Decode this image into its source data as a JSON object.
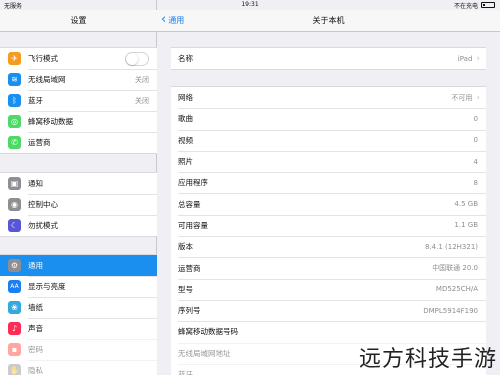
{
  "status_bar": {
    "carrier": "无服务",
    "time": "19:31",
    "charging": "不在充电",
    "battery_level": 0.15
  },
  "left": {
    "title": "设置",
    "group1": [
      {
        "label": "飞行模式",
        "icon": "airplane-icon",
        "color": "#f59b20",
        "glyph": "✈",
        "toggle": "off"
      },
      {
        "label": "无线局域网",
        "icon": "wifi-icon",
        "color": "#1a8ff0",
        "glyph": "≋",
        "value": "关闭"
      },
      {
        "label": "蓝牙",
        "icon": "bluetooth-icon",
        "color": "#1a8ff0",
        "glyph": "ᛒ",
        "value": "关闭"
      },
      {
        "label": "蜂窝移动数据",
        "icon": "cellular-icon",
        "color": "#4cd964",
        "glyph": "◎"
      },
      {
        "label": "运营商",
        "icon": "phone-icon",
        "color": "#4cd964",
        "glyph": "✆"
      }
    ],
    "group2": [
      {
        "label": "通知",
        "icon": "notifications-icon",
        "color": "#8e8e93",
        "glyph": "▣"
      },
      {
        "label": "控制中心",
        "icon": "control-center-icon",
        "color": "#8e8e93",
        "glyph": "◉"
      },
      {
        "label": "勿扰模式",
        "icon": "do-not-disturb-icon",
        "color": "#5856d6",
        "glyph": "☾"
      }
    ],
    "group3": [
      {
        "label": "通用",
        "icon": "gear-icon",
        "color": "#8e8e93",
        "glyph": "⚙",
        "selected": true
      },
      {
        "label": "显示与亮度",
        "icon": "display-brightness-icon",
        "color": "#1a7ff0",
        "glyph": "A"
      },
      {
        "label": "墙纸",
        "icon": "wallpaper-icon",
        "color": "#34aadc",
        "glyph": "❀"
      },
      {
        "label": "声音",
        "icon": "sound-icon",
        "color": "#ff2d55",
        "glyph": "♪"
      },
      {
        "label": "密码",
        "icon": "passcode-icon",
        "color": "#ff3b30",
        "glyph": "▪",
        "faded": true
      },
      {
        "label": "隐私",
        "icon": "privacy-icon",
        "color": "#8e8e93",
        "glyph": "✋",
        "faded": true
      }
    ]
  },
  "right": {
    "back_label": "通用",
    "title": "关于本机",
    "name_row": {
      "label": "名称",
      "value": "iPad"
    },
    "rows": [
      {
        "label": "网络",
        "value": "不可用",
        "chevron": true
      },
      {
        "label": "歌曲",
        "value": "0"
      },
      {
        "label": "视频",
        "value": "0"
      },
      {
        "label": "照片",
        "value": "4"
      },
      {
        "label": "应用程序",
        "value": "8"
      },
      {
        "label": "总容量",
        "value": "4.5 GB"
      },
      {
        "label": "可用容量",
        "value": "1.1 GB"
      },
      {
        "label": "版本",
        "value": "8.4.1 (12H321)"
      },
      {
        "label": "运营商",
        "value": "中国联通 20.0"
      },
      {
        "label": "型号",
        "value": "MD525CH/A"
      },
      {
        "label": "序列号",
        "value": "DMPL5914F190"
      },
      {
        "label": "蜂窝移动数据号码",
        "value": ""
      },
      {
        "label": "无线局域网地址",
        "value": "",
        "faded": true
      },
      {
        "label": "蓝牙",
        "value": "",
        "faded": true
      }
    ]
  },
  "watermark": "远方科技手游"
}
